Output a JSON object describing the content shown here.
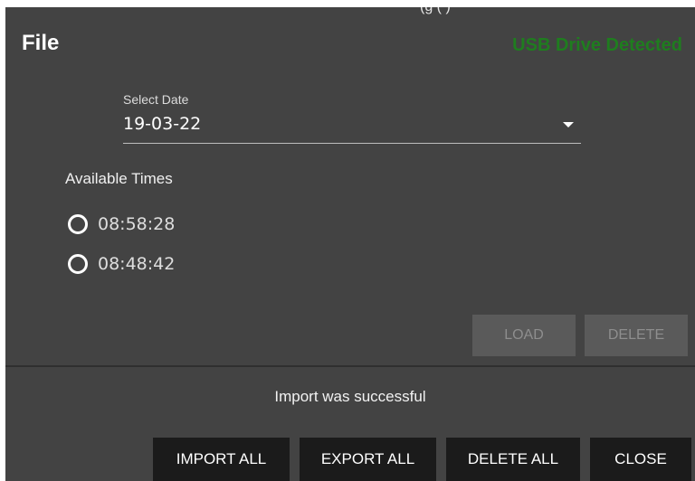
{
  "dialog": {
    "title": "File",
    "usb_status": "USB Drive Detected",
    "clipped_header_text": "(g (           )"
  },
  "date_select": {
    "label": "Select Date",
    "value": "19-03-22",
    "caret_icon": "caret-down-icon"
  },
  "times": {
    "label": "Available Times",
    "options": [
      {
        "label": "08:58:28",
        "selected": false
      },
      {
        "label": "08:48:42",
        "selected": false
      }
    ]
  },
  "actions": {
    "load_label": "LOAD",
    "delete_label": "DELETE"
  },
  "status_message": "Import was successful",
  "footer": {
    "import_all_label": "IMPORT ALL",
    "export_all_label": "EXPORT ALL",
    "delete_all_label": "DELETE ALL",
    "close_label": "CLOSE"
  },
  "colors": {
    "dialog_bg": "#434343",
    "usb_status": "#1f7d1f",
    "footer_button_bg": "#1b1b1b",
    "disabled_button_bg": "#5a5a5a"
  }
}
